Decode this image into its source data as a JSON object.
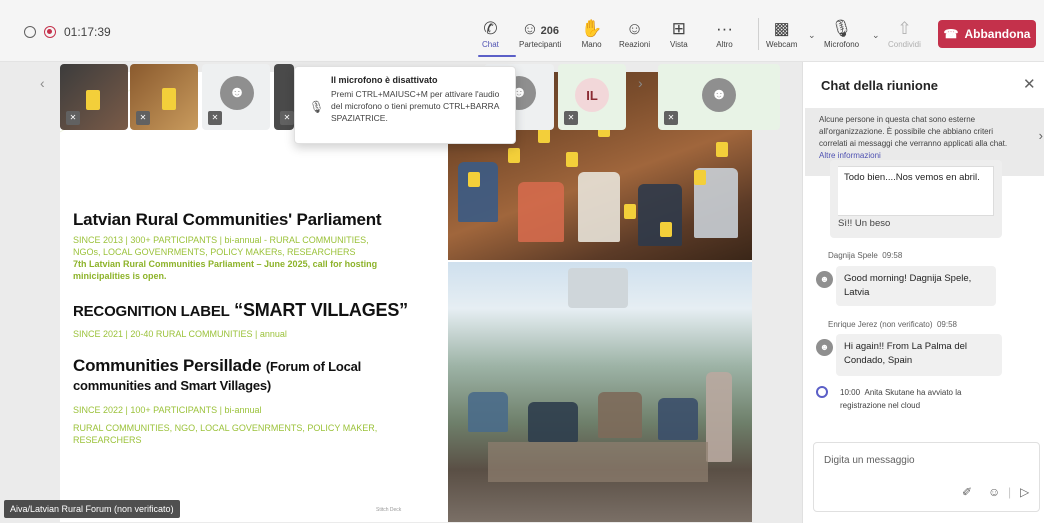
{
  "recording": {
    "elapsed": "01:17:39"
  },
  "toolbar": {
    "chat": "Chat",
    "participants": "Partecipanti",
    "participants_count": "206",
    "hand": "Mano",
    "reactions": "Reazioni",
    "view": "Vista",
    "more": "Altro",
    "webcam": "Webcam",
    "mic": "Microfono",
    "share": "Condividi",
    "leave": "Abbandona"
  },
  "participants_strip": [
    {
      "initials": "",
      "type": "video"
    },
    {
      "initials": "",
      "type": "video"
    },
    {
      "initials": "",
      "type": "avatar"
    },
    {
      "initials": "",
      "type": "video"
    },
    {
      "initials": "",
      "type": "avatar"
    },
    {
      "initials": "IL",
      "type": "initials"
    },
    {
      "initials": "",
      "type": "avatar"
    }
  ],
  "tooltip": {
    "title": "Il microfono è disattivato",
    "body": "Premi CTRL+MAIUSC+M per attivare l'audio del microfono o tieni premuto CTRL+BARRA SPAZIATRICE."
  },
  "slide": {
    "title1": "Latvian Rural Communities' Parliament",
    "line1a": "SINCE 2013  |   300+ PARTICIPANTS   |  bi-annual  - RURAL COMMUNITIES,",
    "line1b": "NGOs, LOCAL GOVENRMENTS, POLICY MAKERs, RESEARCHERS",
    "line1c": "7th Latvian Rural Communities Parliament – June 2025, call for hosting",
    "line1d": "minicipalities is open.",
    "title2a": "RECOGNITION LABEL",
    "title2b": "“SMART VILLAGES”",
    "line2": "SINCE 2021   |   20-40 RURAL COMMUNITIES | annual",
    "title3a": "Communities Persillade",
    "title3b": "(Forum of Local",
    "title3c": "communities and Smart Villages)",
    "line3a": "SINCE 2022 | 100+ PARTICIPANTS | bi-annual",
    "line3b": "RURAL COMMUNITIES, NGO, LOCAL GOVENRMENTS, POLICY MAKER,",
    "line3c": "RESEARCHERS",
    "footnote": "Stitch Deck"
  },
  "speaker_name": "Aiva/Latvian Rural Forum (non verificato)",
  "chat": {
    "title": "Chat della riunione",
    "banner": "Alcune persone in questa chat sono esterne all'organizzazione. È possibile che abbiano criteri correlati ai messaggi che verranno applicati alla chat.",
    "banner_link": "Altre informazioni",
    "quoted": "Todo bien....Nos vemos en abril.",
    "reply": "Sì!! Un beso",
    "messages": [
      {
        "author": "Dagnija Spele",
        "time": "09:58",
        "text": "Good morning! Dagnija Spele, Latvia"
      },
      {
        "author": "Enrique Jerez (non verificato)",
        "time": "09:58",
        "text": "Hi again!! From La Palma del Condado, Spain"
      }
    ],
    "system": {
      "time": "10:00",
      "text": "Anita Skutane ha avviato la registrazione nel cloud"
    },
    "composer_placeholder": "Digita un messaggio"
  },
  "colors": {
    "accent": "#5b5fc7",
    "leave": "#c4314b",
    "slide_green": "#9bc23a"
  }
}
